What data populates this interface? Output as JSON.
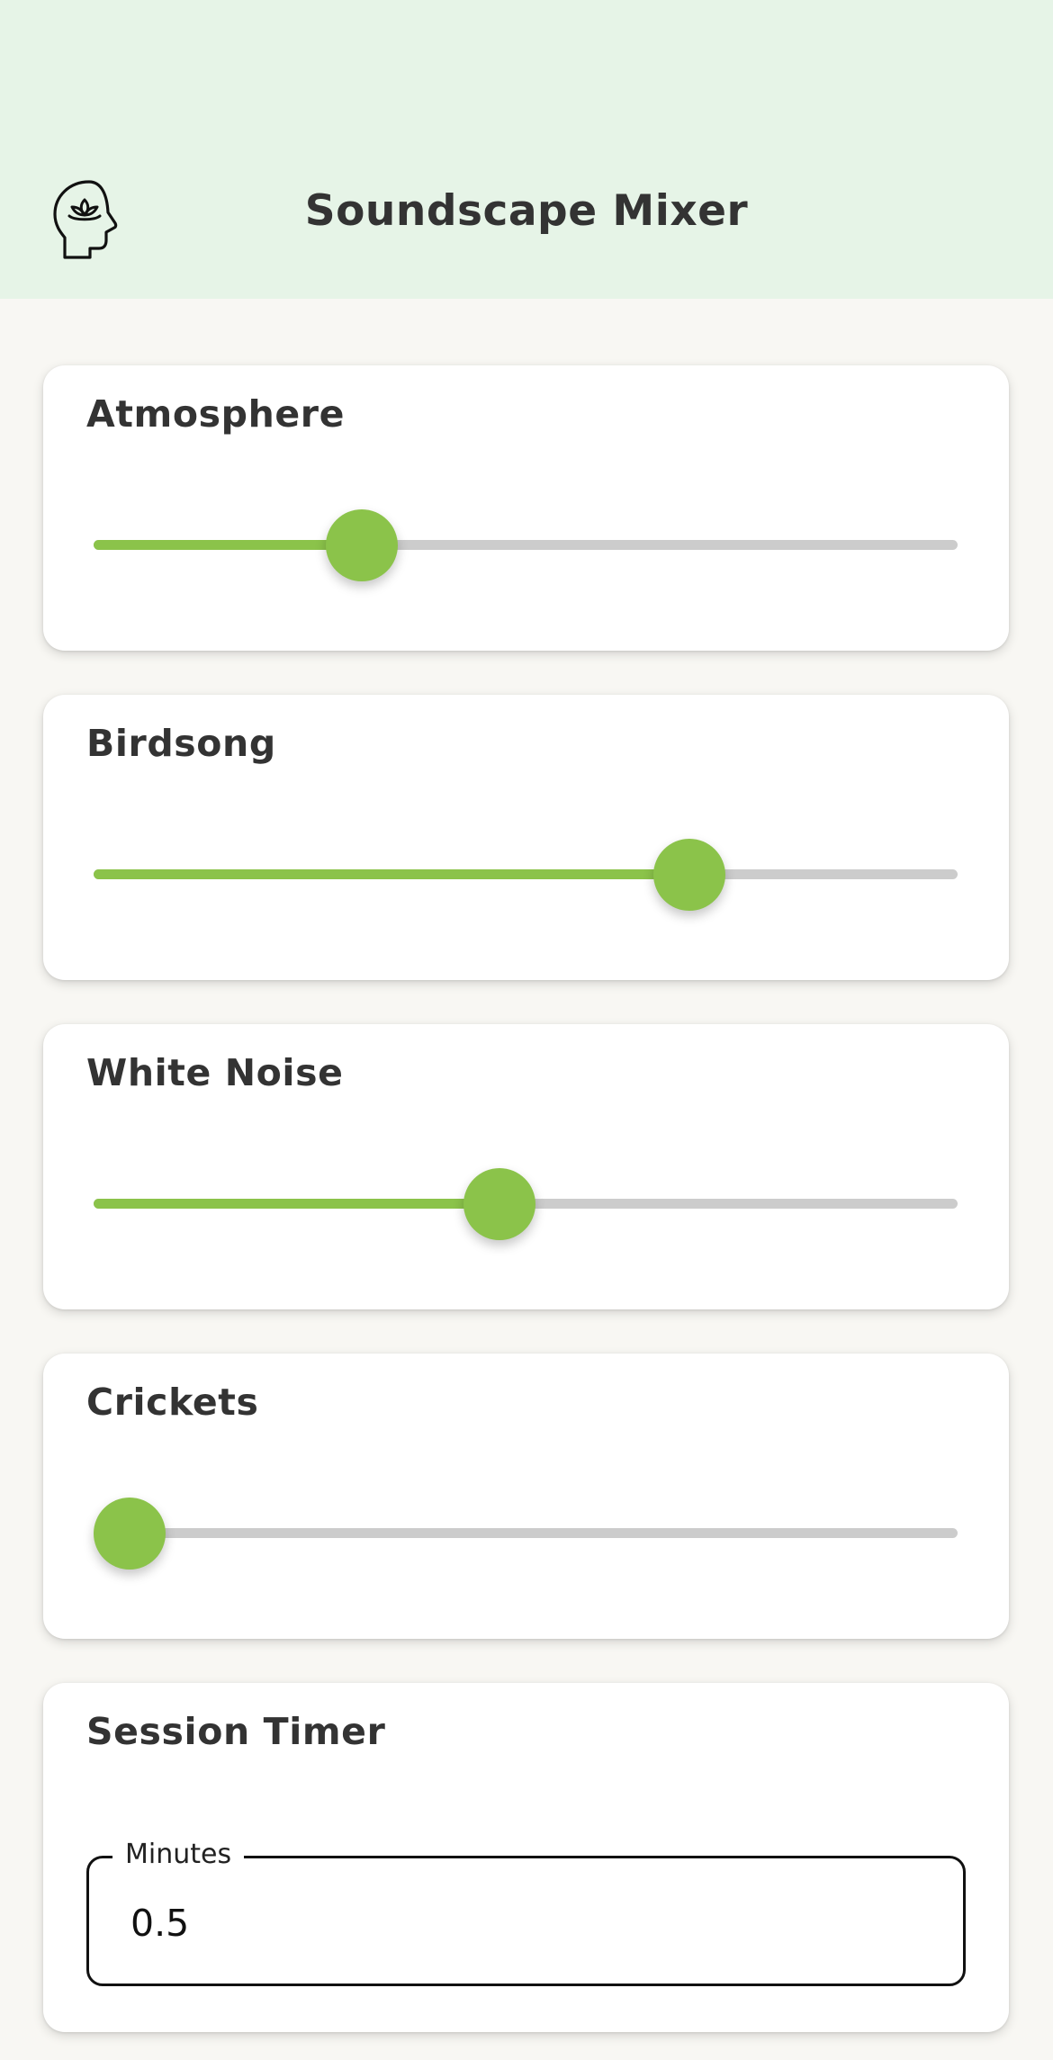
{
  "header": {
    "title": "Soundscape Mixer",
    "icon": "mindful-head-lotus-icon",
    "background": "#e6f4e7"
  },
  "colors": {
    "accent": "#8bc34a",
    "track": "#cccccc",
    "page_background": "#f8f7f3"
  },
  "mixer": {
    "channels": [
      {
        "label": "Atmosphere",
        "level": 0.31
      },
      {
        "label": "Birdsong",
        "level": 0.69
      },
      {
        "label": "White Noise",
        "level": 0.47
      },
      {
        "label": "Crickets",
        "level": 0.0
      }
    ]
  },
  "timer": {
    "title": "Session Timer",
    "field_label": "Minutes",
    "value": "0.5"
  }
}
